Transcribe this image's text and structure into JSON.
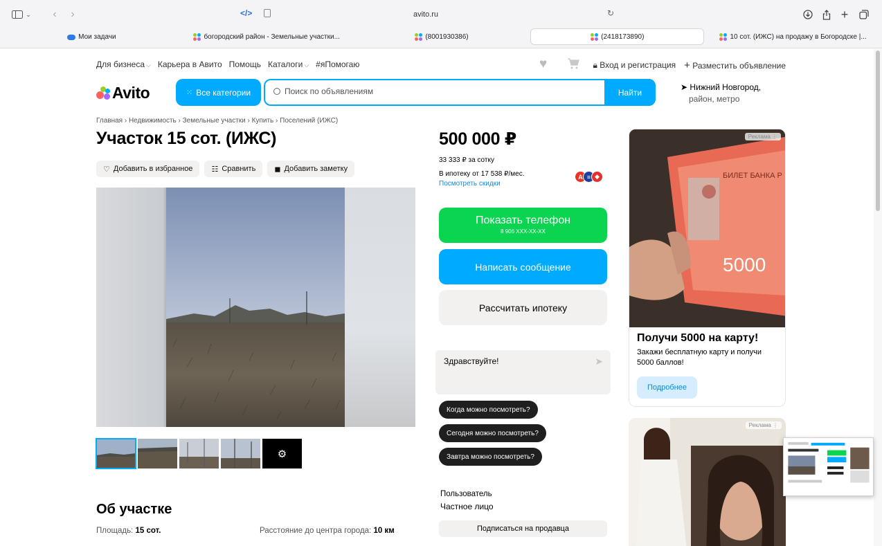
{
  "browser": {
    "url": "avito.ru",
    "tabs": [
      {
        "label": "Мои задачи",
        "active": false
      },
      {
        "label": "богородский район - Земельные участки...",
        "active": false
      },
      {
        "label": "(8001930386)",
        "active": false
      },
      {
        "label": "(2418173890)",
        "active": true
      },
      {
        "label": "10 сот. (ИЖС) на продажу в Богородске |...",
        "active": false
      }
    ]
  },
  "topnav": {
    "business": "Для бизнеса",
    "career": "Карьера в Авито",
    "help": "Помощь",
    "catalogs": "Каталоги",
    "tag": "#яПомогаю",
    "login": "Вход и регистрация",
    "post": "Разместить объявление"
  },
  "header": {
    "logo": "Avito",
    "all_categories": "Все категории",
    "search_placeholder": "Поиск по объявлениям",
    "search_button": "Найти",
    "location_city": "Нижний Новгород,",
    "location_sub": "район, метро"
  },
  "listing": {
    "breadcrumbs": "Главная › Недвижимость › Земельные участки › Купить › Поселений (ИЖС)",
    "title": "Участок 15 сот. (ИЖС)",
    "actions": {
      "favorite": "Добавить в избранное",
      "compare": "Сравнить",
      "note": "Добавить заметку"
    },
    "photo_count": 5,
    "about_title": "Об участке",
    "area_label": "Площадь:",
    "area_value": "15 сот.",
    "distance_label": "Расстояние до центра города:",
    "distance_value": "10 км"
  },
  "sidebar": {
    "price": "500 000 ₽",
    "per_sotka": "33 333 ₽ за сотку",
    "mortgage": "В ипотеку от 17 538 ₽/мес.",
    "discounts": "Посмотреть скидки",
    "show_phone": "Показать телефон",
    "phone_mask": "8 906 XXX-XX-XX",
    "write_message": "Написать сообщение",
    "calc_mortgage": "Рассчитать ипотеку",
    "chat_greeting": "Здравствуйте!",
    "chips": [
      "Когда можно посмотреть?",
      "Сегодня можно посмотреть?",
      "Завтра можно посмотреть?"
    ],
    "seller_label": "Пользователь",
    "seller_type": "Частное лицо",
    "subscribe": "Подписаться на продавца"
  },
  "ads": {
    "tag": "Реклама",
    "ad1_title": "Получи 5000 на карту!",
    "ad1_text": "Закажи бесплатную карту и получи 5000 баллов!",
    "ad1_button": "Подробнее",
    "banknote_text": "БИЛЕТ БАНКА Р",
    "banknote_value": "5000"
  },
  "colors": {
    "accent": "#00aaff",
    "green": "#0bd450",
    "chip": "#1f1f1f",
    "light": "#f2f1f0"
  }
}
